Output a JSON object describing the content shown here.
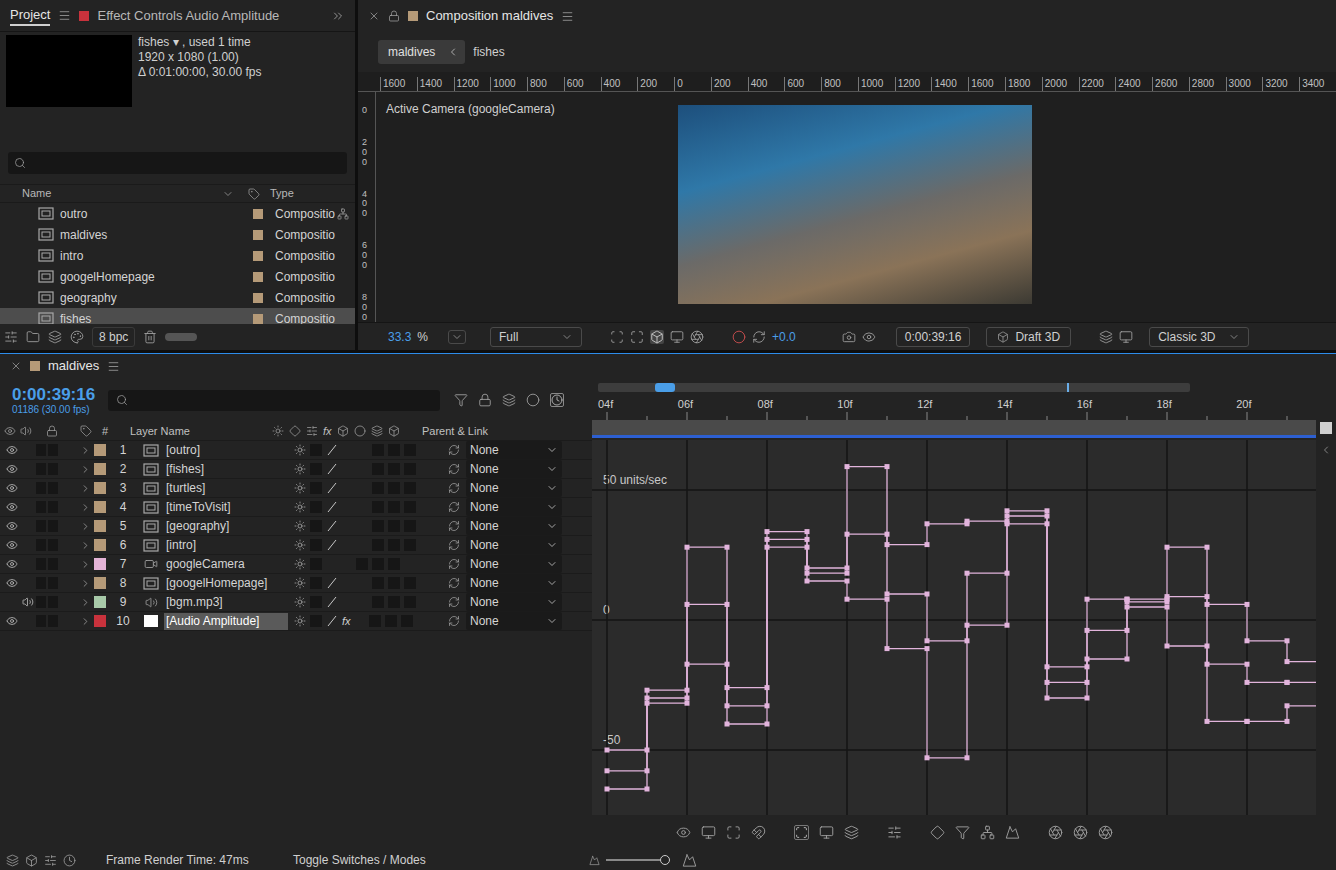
{
  "project": {
    "tabs": [
      {
        "label": "Project",
        "selected": true
      },
      {
        "label": "Effect Controls Audio Amplitude",
        "selected": false,
        "color": "#c8323c"
      }
    ],
    "item_name": "fishes ▾ , used 1 time",
    "info": [
      "1920 x 1080 (1.00)",
      "Δ 0:01:00:00, 30.00 fps"
    ],
    "columns": [
      "Name",
      "Type"
    ],
    "items": [
      {
        "name": "outro",
        "type": "Compositio",
        "selected": false,
        "flow": true
      },
      {
        "name": "maldives",
        "type": "Compositio",
        "selected": false,
        "flow": false
      },
      {
        "name": "intro",
        "type": "Compositio",
        "selected": false,
        "flow": false
      },
      {
        "name": "googelHomepage",
        "type": "Compositio",
        "selected": false,
        "flow": false
      },
      {
        "name": "geography",
        "type": "Compositio",
        "selected": false,
        "flow": false
      },
      {
        "name": "fishes",
        "type": "Compositio",
        "selected": true,
        "flow": false
      }
    ],
    "bit_depth": "8 bpc"
  },
  "viewer": {
    "tab": "Composition maldives",
    "breadcrumbs": [
      {
        "label": "maldives",
        "selected": true
      },
      {
        "label": "fishes",
        "selected": false
      }
    ],
    "ruler": [
      "1600",
      "1400",
      "1200",
      "1000",
      "800",
      "600",
      "400",
      "200",
      "0",
      "200",
      "400",
      "600",
      "800",
      "1000",
      "1200",
      "1400",
      "1600",
      "1800",
      "2000",
      "2200",
      "2400",
      "2600",
      "2800",
      "3000",
      "3200",
      "3400"
    ],
    "side_ruler": [
      "0",
      "200",
      "400",
      "600",
      "800"
    ],
    "camera_label": "Active Camera (googleCamera)",
    "zoom": "33.3",
    "zoom_unit": "%",
    "resolution": "Full",
    "exposure": "+0.0",
    "timecode": "0:00:39:16",
    "renderer": "Draft 3D",
    "mode": "Classic 3D"
  },
  "timeline": {
    "tab": "maldives",
    "timecode": "0:00:39:16",
    "frame": "01186 (30.00 fps)",
    "columns": {
      "number": "#",
      "name": "Layer Name",
      "fx": "fx",
      "parent": "Parent & Link"
    },
    "layers": [
      {
        "number": "1",
        "name": "[outro]",
        "kind": "comp",
        "color": "#b59a78",
        "video": true,
        "audio": false,
        "selected": false,
        "fx": "",
        "parent": "None"
      },
      {
        "number": "2",
        "name": "[fishes]",
        "kind": "comp",
        "color": "#b59a78",
        "video": true,
        "audio": false,
        "selected": false,
        "fx": "",
        "parent": "None"
      },
      {
        "number": "3",
        "name": "[turtles]",
        "kind": "comp",
        "color": "#b59a78",
        "video": true,
        "audio": false,
        "selected": false,
        "fx": "",
        "parent": "None"
      },
      {
        "number": "4",
        "name": "[timeToVisit]",
        "kind": "comp",
        "color": "#b59a78",
        "video": true,
        "audio": false,
        "selected": false,
        "fx": "",
        "parent": "None"
      },
      {
        "number": "5",
        "name": "[geography]",
        "kind": "comp",
        "color": "#b59a78",
        "video": true,
        "audio": false,
        "selected": false,
        "fx": "",
        "parent": "None"
      },
      {
        "number": "6",
        "name": "[intro]",
        "kind": "comp",
        "color": "#b59a78",
        "video": true,
        "audio": false,
        "selected": false,
        "fx": "",
        "parent": "None"
      },
      {
        "number": "7",
        "name": "googleCamera",
        "kind": "camera",
        "color": "#e4b3d6",
        "video": true,
        "audio": false,
        "selected": false,
        "fx": "",
        "parent": "None"
      },
      {
        "number": "8",
        "name": "[googelHomepage]",
        "kind": "comp",
        "color": "#b59a78",
        "video": true,
        "audio": false,
        "selected": false,
        "fx": "",
        "parent": "None"
      },
      {
        "number": "9",
        "name": "[bgm.mp3]",
        "kind": "audio",
        "color": "#a7c9a8",
        "video": false,
        "audio": true,
        "selected": false,
        "fx": "",
        "parent": "None"
      },
      {
        "number": "10",
        "name": "[Audio Amplitude]",
        "kind": "solid",
        "color": "#c8323c",
        "video": true,
        "audio": false,
        "selected": true,
        "fx": "fx",
        "parent": "None"
      }
    ],
    "ruler": [
      "04f",
      "06f",
      "08f",
      "10f",
      "12f",
      "14f",
      "16f",
      "18f",
      "20f"
    ],
    "graph": {
      "axis": [
        {
          "label": "50 units/sec",
          "value": 50
        },
        {
          "label": "0",
          "value": 0
        },
        {
          "label": "-50",
          "value": -50
        }
      ],
      "start_frame": 4,
      "series": [
        {
          "color": "#e2b4dc",
          "values": [
            -50,
            -27,
            28,
            -26,
            34,
            20,
            59,
            29,
            37,
            38,
            42,
            -18,
            8,
            8,
            28,
            6,
            -8,
            -16
          ]
        },
        {
          "color": "#e2b4dc",
          "values": [
            -58,
            -30,
            6,
            -33,
            31,
            18,
            33,
            10,
            -8,
            18,
            40,
            -24,
            -4,
            7,
            9,
            -17,
            -24,
            -24
          ]
        },
        {
          "color": "#e2b4dc",
          "values": [
            -65,
            -32,
            -17,
            -40,
            28,
            15,
            8,
            -11,
            -53,
            -2,
            37,
            -30,
            -15,
            5,
            -10,
            -39,
            -39,
            -33
          ]
        }
      ]
    },
    "status": {
      "render_time": "Frame Render Time: 47ms",
      "toggle": "Toggle Switches / Modes"
    }
  }
}
